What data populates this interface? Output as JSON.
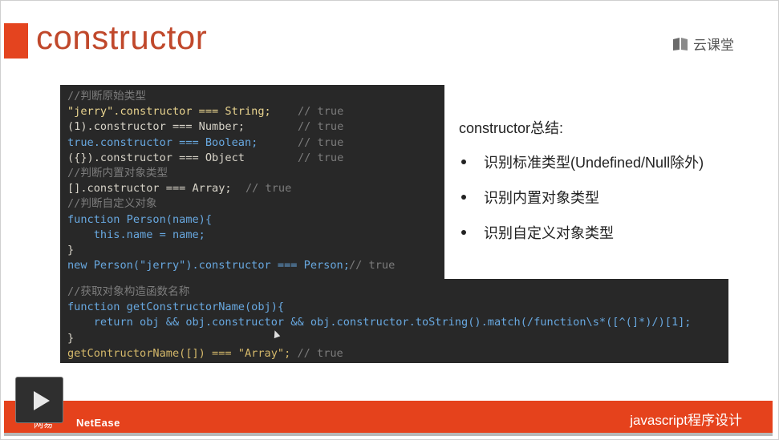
{
  "slide": {
    "title": "constructor",
    "brand": {
      "label": "云课堂",
      "icon": "book-icon"
    },
    "code_block_1": [
      {
        "text": "//判断原始类型",
        "kind": "comment"
      },
      {
        "text": "\"jerry\".constructor === String;",
        "kind": "code",
        "trail": "// true"
      },
      {
        "text": "(1).constructor === Number;",
        "kind": "code",
        "trail": "// true"
      },
      {
        "text": "true.constructor === Boolean;",
        "kind": "code",
        "trail": "// true"
      },
      {
        "text": "({}).constructor === Object",
        "kind": "code",
        "trail": "// true"
      },
      {
        "text": "//判断内置对象类型",
        "kind": "comment"
      },
      {
        "text": "[].constructor === Array;",
        "kind": "code",
        "trail": "// true"
      },
      {
        "text": "//判断自定义对象",
        "kind": "comment"
      },
      {
        "text": "function Person(name){",
        "kind": "code"
      },
      {
        "text": "    this.name = name;",
        "kind": "code"
      },
      {
        "text": "}",
        "kind": "code"
      },
      {
        "text": "new Person(\"jerry\").constructor === Person;",
        "kind": "code",
        "trail": "// true"
      }
    ],
    "code_block_2": [
      {
        "text": "//获取对象构造函数名称",
        "kind": "comment"
      },
      {
        "text": "function getConstructorName(obj){",
        "kind": "code"
      },
      {
        "text": "    return obj && obj.constructor && obj.constructor.toString().match(/function\\s*([^(]*)/)[1];",
        "kind": "code"
      },
      {
        "text": "}",
        "kind": "code"
      },
      {
        "text": "getContructorName([]) === \"Array\";",
        "kind": "code",
        "trail": "// true"
      }
    ],
    "summary": {
      "title": "constructor总结:",
      "bullets": [
        "识别标准类型(Undefined/Null除外)",
        "识别内置对象类型",
        "识别自定义对象类型"
      ]
    },
    "footer": {
      "course": "javascript程序设计",
      "company": "NetEase",
      "logo_text": "网易"
    }
  },
  "player": {
    "play_icon": "play-icon"
  }
}
